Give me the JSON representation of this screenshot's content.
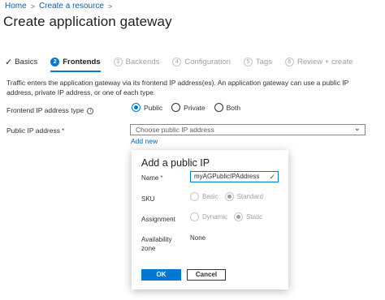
{
  "breadcrumb": {
    "home": "Home",
    "create_resource": "Create a resource",
    "separator": ">"
  },
  "page": {
    "title": "Create application gateway",
    "more": "···"
  },
  "tabs": [
    {
      "label": "Basics",
      "state": "done",
      "icon": "check-icon"
    },
    {
      "number": "2",
      "label": "Frontends",
      "state": "active"
    },
    {
      "number": "3",
      "label": "Backends",
      "state": "disabled"
    },
    {
      "number": "4",
      "label": "Configuration",
      "state": "disabled"
    },
    {
      "number": "5",
      "label": "Tags",
      "state": "disabled"
    },
    {
      "number": "6",
      "label": "Review + create",
      "state": "disabled"
    }
  ],
  "description": "Traffic enters the application gateway via its frontend IP address(es). An application gateway can use a public IP address, private IP address, or one of each type.",
  "frontend_ip": {
    "label": "Frontend IP address type",
    "options": [
      {
        "label": "Public",
        "selected": true
      },
      {
        "label": "Private",
        "selected": false
      },
      {
        "label": "Both",
        "selected": false
      }
    ]
  },
  "public_ip": {
    "label": "Public IP address",
    "required": "*",
    "placeholder": "Choose public IP address",
    "add_new": "Add new"
  },
  "callout": {
    "title": "Add a public IP",
    "name_label": "Name",
    "name_required": "*",
    "name_value": "myAGPublicIPAddress",
    "sku_label": "SKU",
    "sku_options": [
      {
        "label": "Basic",
        "selected": false
      },
      {
        "label": "Standard",
        "selected": true
      }
    ],
    "assignment_label": "Assignment",
    "assignment_options": [
      {
        "label": "Dynamic",
        "selected": false
      },
      {
        "label": "Static",
        "selected": true
      }
    ],
    "zone_label_line1": "Availability",
    "zone_label_line2": "zone",
    "zone_value": "None",
    "ok_label": "OK",
    "cancel_label": "Cancel"
  },
  "colors": {
    "accent": "#0078d4",
    "link": "#0062ad",
    "required": "#a4262c",
    "valid": "#107c10"
  }
}
